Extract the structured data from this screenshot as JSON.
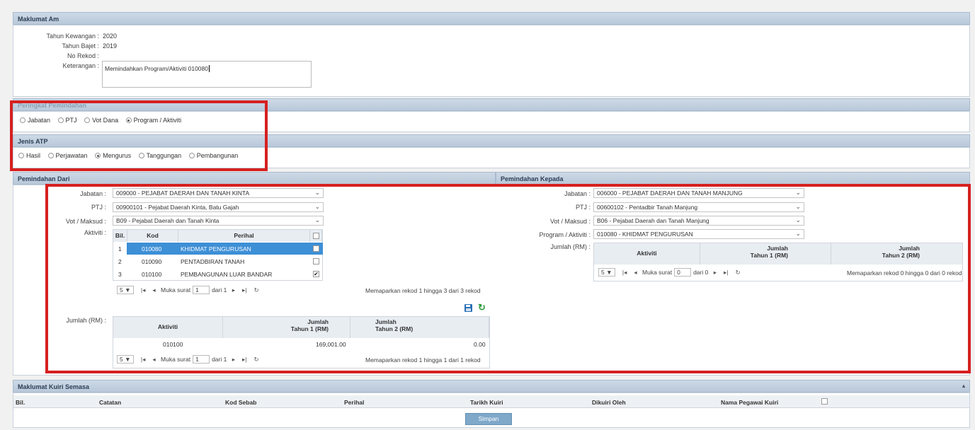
{
  "maklumat_am": {
    "title": "Maklumat Am",
    "tahun_kewangan_label": "Tahun Kewangan :",
    "tahun_kewangan": "2020",
    "tahun_bajet_label": "Tahun Bajet :",
    "tahun_bajet": "2019",
    "no_rekod_label": "No Rekod :",
    "no_rekod": "",
    "keterangan_label": "Keterangan :",
    "keterangan": "Memindahkan Program/Aktiviti 010080"
  },
  "peringkat": {
    "title": "Peringkat Pemindahan",
    "options": [
      "Jabatan",
      "PTJ",
      "Vot Dana",
      "Program / Aktiviti"
    ],
    "selected": "Program / Aktiviti"
  },
  "jenis_atp": {
    "title": "Jenis ATP",
    "options": [
      "Hasil",
      "Perjawatan",
      "Mengurus",
      "Tanggungan",
      "Pembangunan"
    ],
    "selected": "Mengurus"
  },
  "dari": {
    "title": "Pemindahan Dari",
    "jabatan_label": "Jabatan :",
    "jabatan": "009000 - PEJABAT DAERAH DAN TANAH KINTA",
    "ptj_label": "PTJ :",
    "ptj": "00900101 - Pejabat Daerah Kinta, Batu Gajah",
    "vot_label": "Vot / Maksud :",
    "vot": "B09 - Pejabat Daerah dan Tanah Kinta",
    "aktiviti_label": "Aktiviti :",
    "aktiviti_headers": [
      "Bil.",
      "Kod",
      "Perihal"
    ],
    "aktiviti_rows": [
      {
        "bil": "1",
        "kod": "010080",
        "perihal": "KHIDMAT PENGURUSAN",
        "checked": false,
        "selected": true
      },
      {
        "bil": "2",
        "kod": "010090",
        "perihal": "PENTADBIRAN TANAH",
        "checked": false,
        "selected": false
      },
      {
        "bil": "3",
        "kod": "010100",
        "perihal": "PEMBANGUNAN LUAR BANDAR",
        "checked": true,
        "selected": false
      }
    ],
    "pager1": {
      "size": "5 ▼",
      "muka": "Muka surat",
      "page": "1",
      "dari": "dari 1",
      "info": "Memaparkan rekod 1 hingga 3 dari 3 rekod"
    },
    "jumlah_label": "Jumlah (RM) :",
    "jumlah_headers": [
      "Aktiviti",
      "Jumlah\nTahun 1 (RM)",
      "Jumlah\nTahun 2 (RM)"
    ],
    "jumlah_h1": "Aktiviti",
    "jumlah_h2a": "Jumlah",
    "jumlah_h2b": "Tahun 1 (RM)",
    "jumlah_h3a": "Jumlah",
    "jumlah_h3b": "Tahun 2 (RM)",
    "jumlah_row": {
      "aktiviti": "010100",
      "tahun1": "169,001.00",
      "tahun2": "0.00"
    },
    "pager2": {
      "size": "5 ▼",
      "muka": "Muka surat",
      "page": "1",
      "dari": "dari 1",
      "info": "Memaparkan rekod 1 hingga 1 dari 1 rekod"
    }
  },
  "kepada": {
    "title": "Pemindahan Kepada",
    "jabatan_label": "Jabatan :",
    "jabatan": "006000 - PEJABAT DAERAH DAN TANAH MANJUNG",
    "ptj_label": "PTJ :",
    "ptj": "00600102 - Pentadbir Tanah Manjung",
    "vot_label": "Vot / Maksud :",
    "vot": "B06 - Pejabat Daerah dan Tanah Manjung",
    "program_label": "Program / Aktiviti :",
    "program": "010080 - KHIDMAT PENGURUSAN",
    "jumlah_label": "Jumlah (RM) :",
    "jumlah_h1": "Aktiviti",
    "jumlah_h2a": "Jumlah",
    "jumlah_h2b": "Tahun 1 (RM)",
    "jumlah_h3a": "Jumlah",
    "jumlah_h3b": "Tahun 2 (RM)",
    "pager": {
      "size": "5 ▼",
      "muka": "Muka surat",
      "page": "0",
      "dari": "dari 0",
      "info": "Memaparkan rekod 0 hingga 0 dari 0 rekod"
    }
  },
  "kuiri": {
    "title": "Maklumat Kuiri Semasa",
    "headers": [
      "Bil.",
      "Catatan",
      "Kod Sebab",
      "Perihal",
      "Tarikh Kuiri",
      "Dikuiri Oleh",
      "Nama Pegawai Kuiri"
    ]
  },
  "simpan_label": "Simpan",
  "colors": {
    "highlight_red": "#d62020",
    "selected_row": "#3d8fd6",
    "section_bar": "#c3d2e1"
  },
  "icons": [
    "save-icon",
    "refresh-icon",
    "first-page-icon",
    "prev-page-icon",
    "next-page-icon",
    "last-page-icon",
    "reload-icon"
  ]
}
